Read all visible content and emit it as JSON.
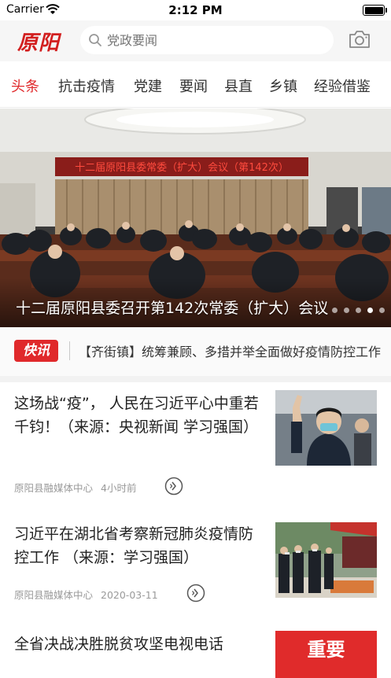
{
  "status_bar": {
    "carrier": "Carrier",
    "time": "2:12 PM"
  },
  "header": {
    "logo_text": "原阳",
    "search_placeholder": "党政要闻",
    "icons": [
      "search-icon",
      "camera-icon"
    ]
  },
  "tabs": [
    {
      "label": "头条",
      "active": true
    },
    {
      "label": "抗击疫情"
    },
    {
      "label": "党建"
    },
    {
      "label": "要闻"
    },
    {
      "label": "县直"
    },
    {
      "label": "乡镇"
    },
    {
      "label": "经验借鉴"
    }
  ],
  "banner": {
    "caption": "十二届原阳县委召开第142次常委（扩大）会议",
    "image_sign_text": "十二届原阳县委常委（扩大）会议（第142次）",
    "slides": 5,
    "active_slide": 4
  },
  "flash": {
    "badge": "快讯",
    "text": "【齐街镇】统筹兼顾、多措并举全面做好疫情防控工作"
  },
  "news": [
    {
      "title": "这场战“疫”， 人民在习近平心中重若千钧！（来源：央视新闻 学习强国）",
      "source": "原阳县融媒体中心",
      "time": "4小时前"
    },
    {
      "title": "习近平在湖北省考察新冠肺炎疫情防控工作 （来源：学习强国）",
      "source": "原阳县融媒体中心",
      "time": "2020-03-11"
    },
    {
      "title": "全省决战决胜脱贫攻坚电视电话",
      "source": "",
      "time": "",
      "thumb_text": "重要"
    }
  ],
  "colors": {
    "accent": "#e0292b",
    "logo": "#d21f1f"
  }
}
